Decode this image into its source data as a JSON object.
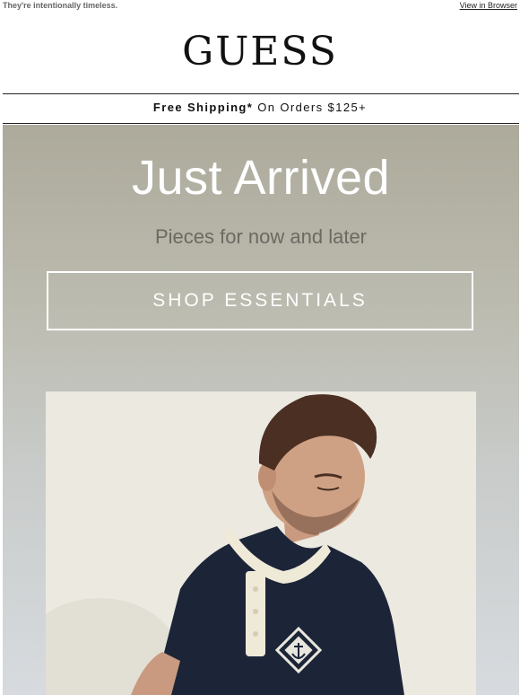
{
  "preheader": {
    "tagline": "They're intentionally timeless.",
    "view_in_browser": "View in Browser"
  },
  "logo": "GUESS",
  "shipping": {
    "bold": "Free Shipping*",
    "rest": "On Orders $125+"
  },
  "hero": {
    "headline": "Just Arrived",
    "subline": "Pieces for now and later",
    "cta": "SHOP ESSENTIALS"
  },
  "colors": {
    "hero_top": "#adaa9b",
    "hero_bottom": "#d7dbdf",
    "shirt": "#1c2538",
    "placket": "#efe9d8"
  }
}
